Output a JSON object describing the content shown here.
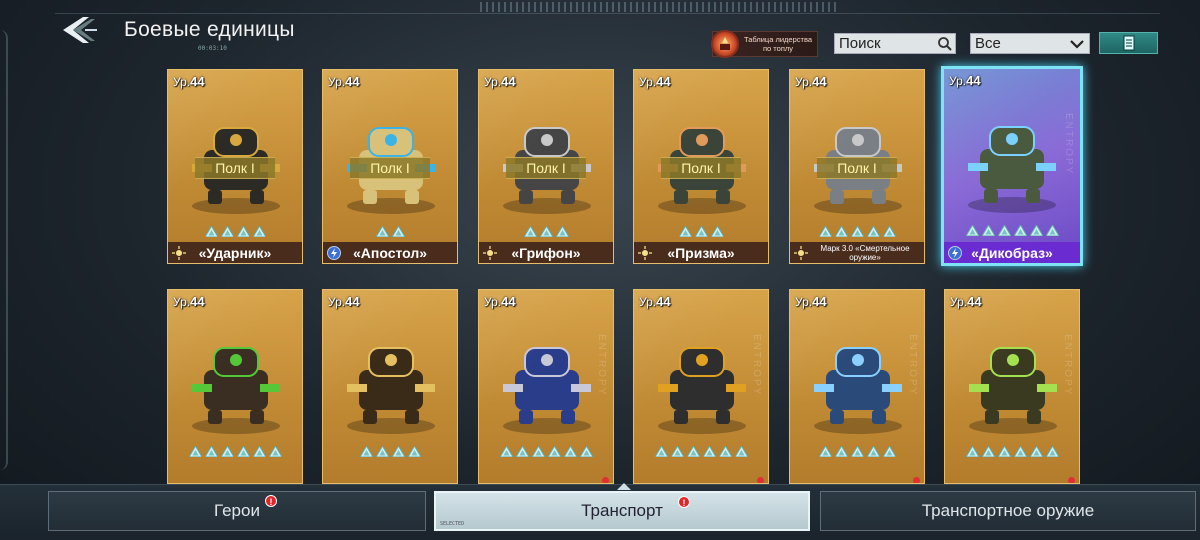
{
  "header": {
    "title": "Боевые единицы",
    "leaderboard_label": "Таблица лидерства по топлу",
    "search_placeholder": "Поиск",
    "filter_value": "Все",
    "subtiny": "00:03:10"
  },
  "colors": {
    "card_gold": "#c8923b",
    "card_selected": "#7f63d8",
    "selected_border": "#7fe3f6",
    "name_bar": "#4a2c1c",
    "badge": "#e02626"
  },
  "cards": [
    {
      "level_prefix": "Ур.",
      "level": "44",
      "regiment": "Полк I",
      "stars": 4,
      "name": "«Ударник»",
      "class_icon": "sun-class-icon"
    },
    {
      "level_prefix": "Ур.",
      "level": "44",
      "regiment": "Полк I",
      "stars": 2,
      "name": "«Апостол»",
      "class_icon": "bolt-class-icon"
    },
    {
      "level_prefix": "Ур.",
      "level": "44",
      "regiment": "Полк I",
      "stars": 3,
      "name": "«Грифон»",
      "class_icon": "sun-class-icon"
    },
    {
      "level_prefix": "Ур.",
      "level": "44",
      "regiment": "Полк I",
      "stars": 3,
      "name": "«Призма»",
      "class_icon": "sun-class-icon"
    },
    {
      "level_prefix": "Ур.",
      "level": "44",
      "regiment": "Полк I",
      "stars": 5,
      "name": "Марк 3.0 «Смертельное оружие»",
      "class_icon": "sun-class-icon"
    },
    {
      "level_prefix": "Ур.",
      "level": "44",
      "regiment": "",
      "stars": 6,
      "name": "«Дикобраз»",
      "class_icon": "bolt-class-icon",
      "selected": true,
      "side_text": "ENTROPY"
    },
    {
      "level_prefix": "Ур.",
      "level": "44",
      "regiment": "",
      "stars": 6,
      "name": "",
      "class_icon": ""
    },
    {
      "level_prefix": "Ур.",
      "level": "44",
      "regiment": "",
      "stars": 4,
      "name": "",
      "class_icon": ""
    },
    {
      "level_prefix": "Ур.",
      "level": "44",
      "regiment": "",
      "stars": 6,
      "name": "",
      "class_icon": "",
      "side_text": "ENTROPY"
    },
    {
      "level_prefix": "Ур.",
      "level": "44",
      "regiment": "",
      "stars": 6,
      "name": "",
      "class_icon": "",
      "side_text": "ENTROPY"
    },
    {
      "level_prefix": "Ур.",
      "level": "44",
      "regiment": "",
      "stars": 5,
      "name": "",
      "class_icon": "",
      "side_text": "ENTROPY"
    },
    {
      "level_prefix": "Ур.",
      "level": "44",
      "regiment": "",
      "stars": 6,
      "name": "",
      "class_icon": "",
      "side_text": "ENTROPY"
    }
  ],
  "tabs": [
    {
      "label": "Герои",
      "badge": "!"
    },
    {
      "label": "Транспорт",
      "badge": "!",
      "sub": "SELECTED"
    },
    {
      "label": "Транспортное оружие"
    }
  ]
}
